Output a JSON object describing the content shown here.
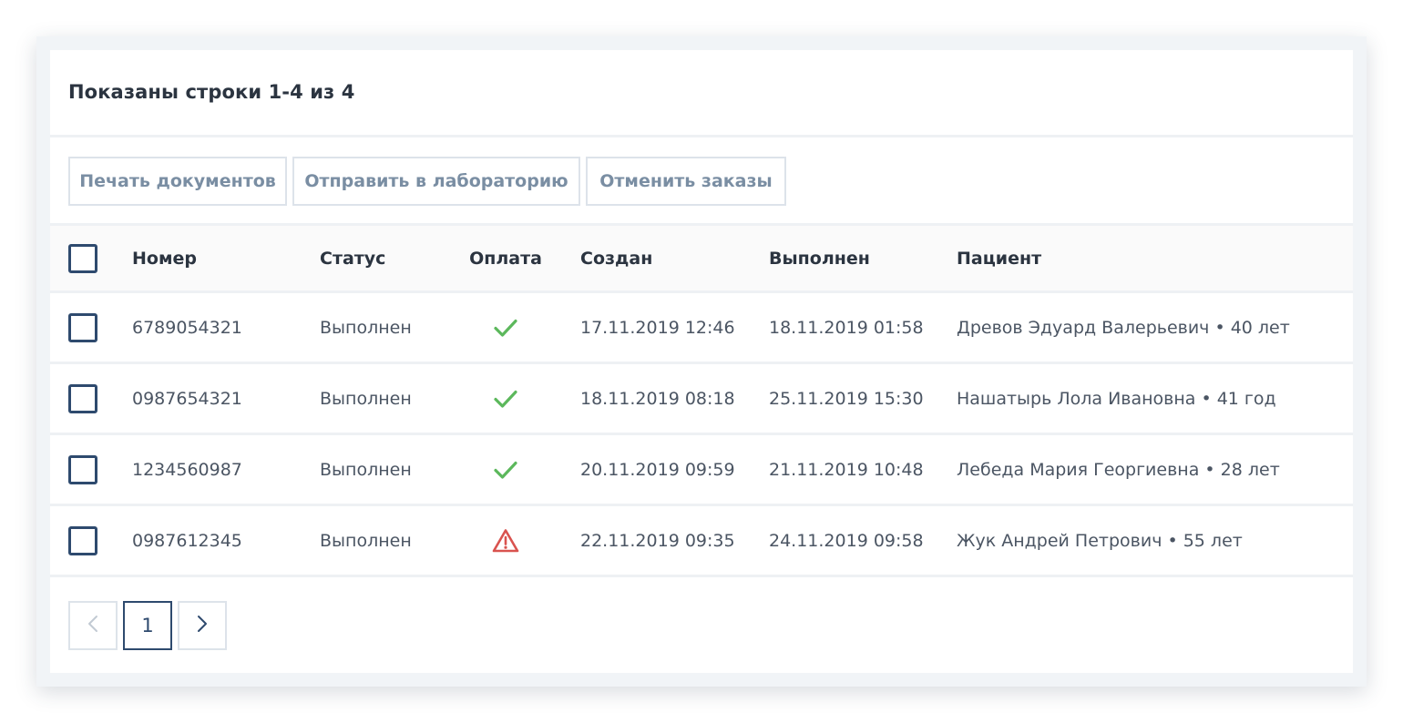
{
  "summary": {
    "text": "Показаны строки 1-4 из 4"
  },
  "toolbar": {
    "print_label": "Печать документов",
    "send_label": "Отправить в лабораторию",
    "cancel_label": "Отменить заказы"
  },
  "table": {
    "columns": {
      "number": "Номер",
      "status": "Статус",
      "payment": "Оплата",
      "created": "Создан",
      "completed": "Выполнен",
      "patient": "Пациент"
    },
    "rows": [
      {
        "number": "6789054321",
        "status": "Выполнен",
        "payment_icon": "check-icon",
        "created": "17.11.2019 12:46",
        "completed": "18.11.2019 01:58",
        "patient": "Древов Эдуард Валерьевич • 40 лет"
      },
      {
        "number": "0987654321",
        "status": "Выполнен",
        "payment_icon": "check-icon",
        "created": "18.11.2019 08:18",
        "completed": "25.11.2019 15:30",
        "patient": "Нашатырь Лола Ивановна • 41 год"
      },
      {
        "number": "1234560987",
        "status": "Выполнен",
        "payment_icon": "check-icon",
        "created": "20.11.2019 09:59",
        "completed": "21.11.2019 10:48",
        "patient": "Лебеда Мария Георгиевна • 28 лет"
      },
      {
        "number": "0987612345",
        "status": "Выполнен",
        "payment_icon": "warning-icon",
        "created": "22.11.2019 09:35",
        "completed": "24.11.2019 09:58",
        "patient": "Жук Андрей Петрович • 55 лет"
      }
    ]
  },
  "pagination": {
    "current_page": "1",
    "prev_icon": "chevron-left-icon",
    "next_icon": "chevron-right-icon"
  },
  "colors": {
    "accent": "#2e4a6e",
    "success": "#5cb85c",
    "danger": "#d9534f",
    "muted_button_text": "#7a8ea3"
  }
}
